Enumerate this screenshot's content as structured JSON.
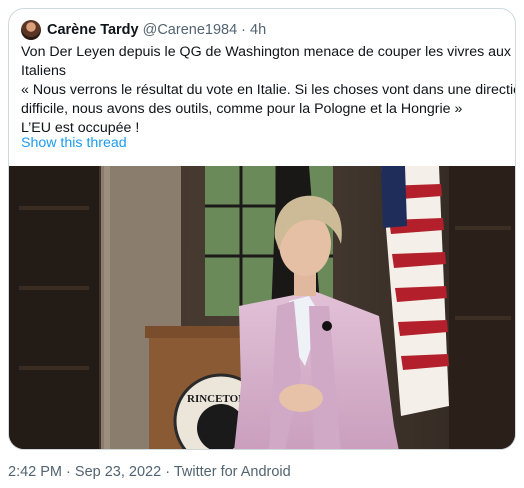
{
  "tweet": {
    "author_name": "Carène Tardy",
    "author_handle": "@Carene1984",
    "separator": "·",
    "relative_time": "4h",
    "lines": [
      "Von Der Leyen depuis le QG de Washington menace de couper les vivres aux",
      "Italiens",
      "« Nous verrons le résultat du vote en Italie. Si les choses vont dans une direction",
      "difficile, nous avons des outils, comme pour la Pologne et la Hongrie »",
      "L’EU est occupée !"
    ],
    "show_thread_label": "Show this thread",
    "media": {
      "seal_text": "RINCETON U"
    }
  },
  "footer": {
    "time": "2:42 PM",
    "sep1": "·",
    "date": "Sep 23, 2022",
    "sep2": "·",
    "client": "Twitter for Android"
  },
  "colors": {
    "link": "#1d9bf0",
    "muted": "#536471",
    "border": "#cfd9de",
    "jacket": "#d9b3cf"
  },
  "icons": [
    "avatar"
  ]
}
